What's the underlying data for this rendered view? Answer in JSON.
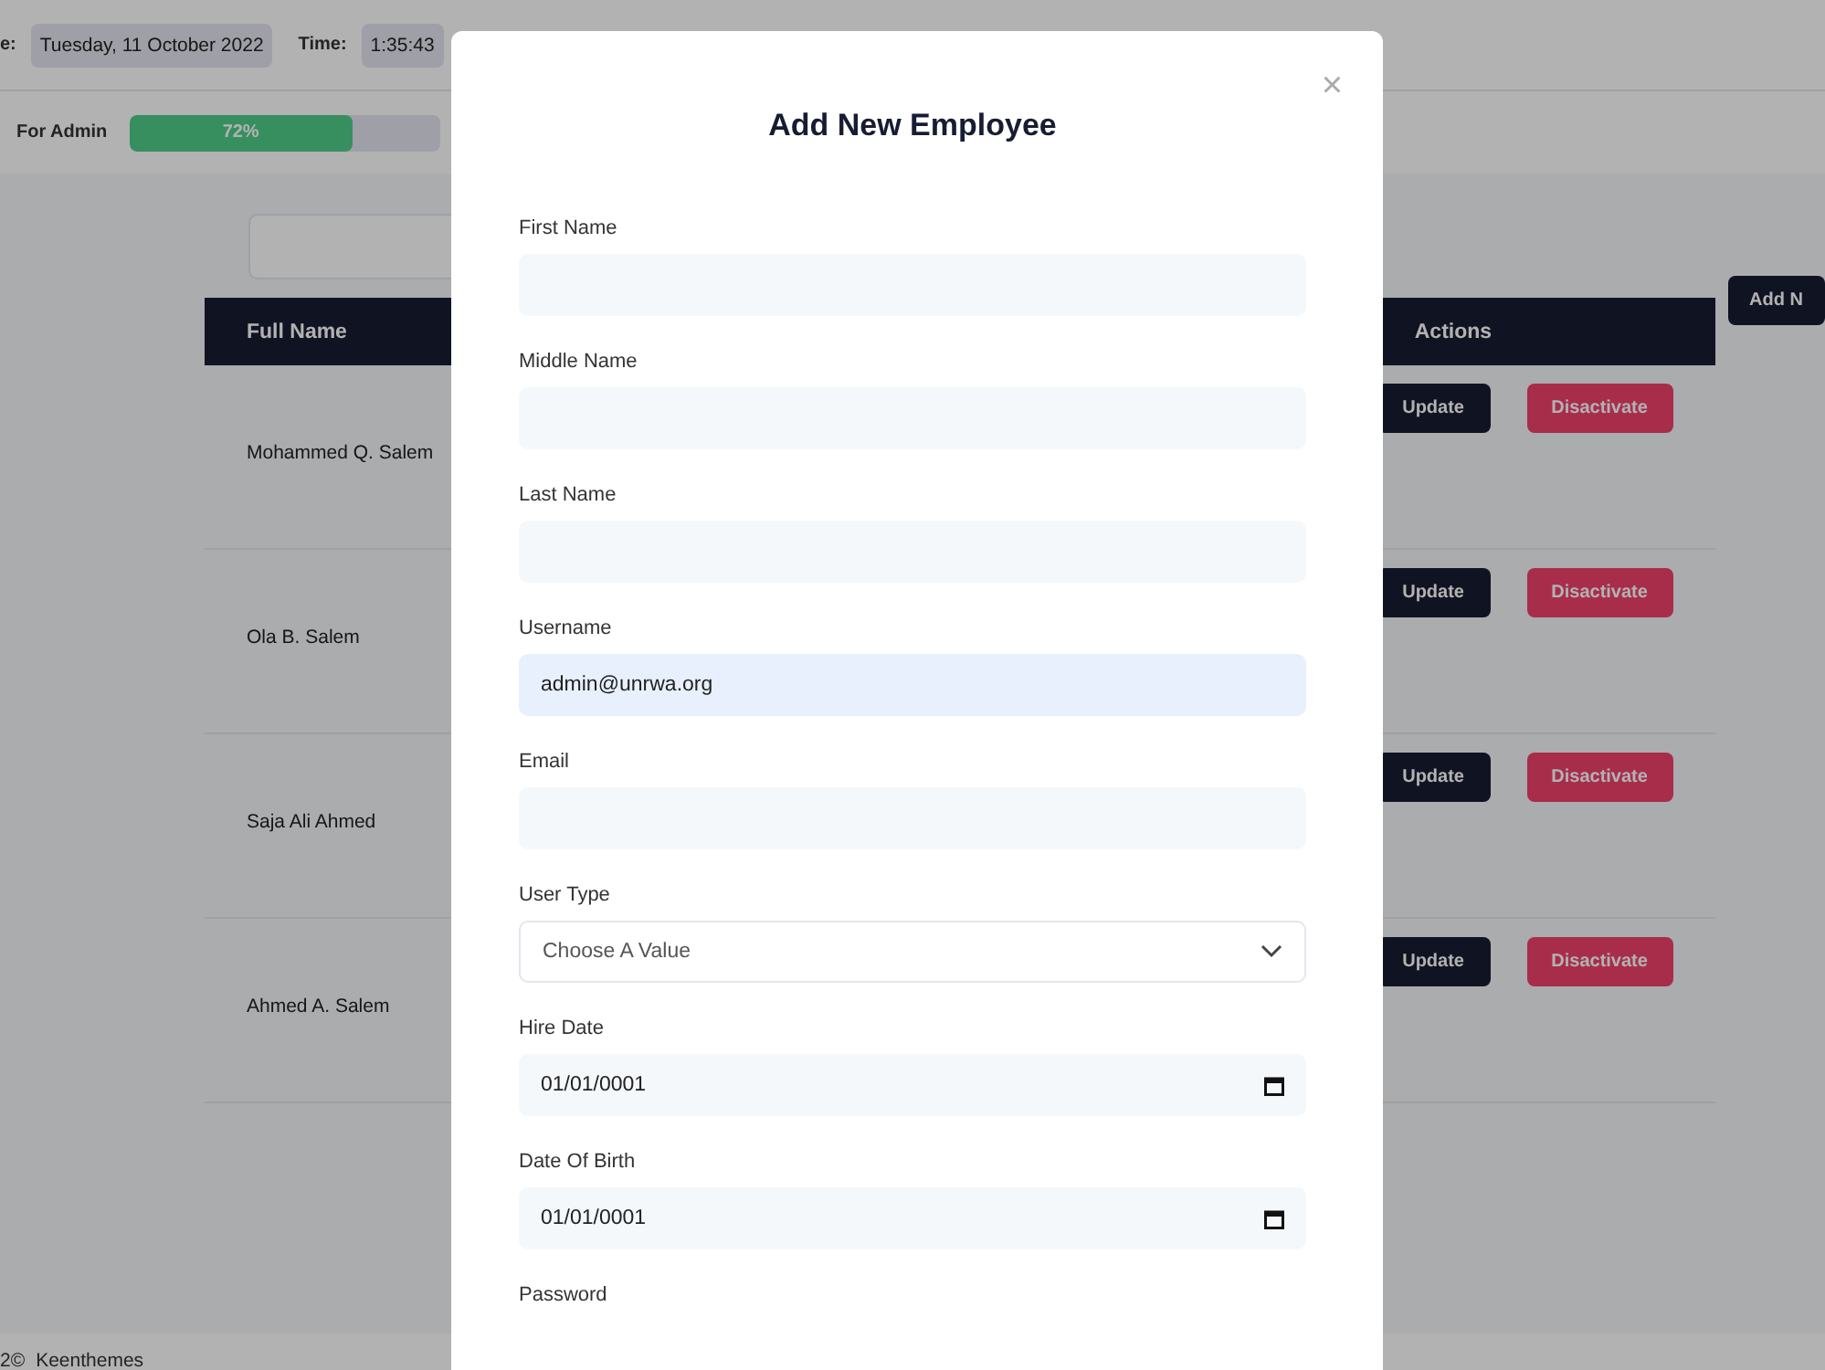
{
  "header": {
    "date_label": "e:",
    "date_value": "Tuesday, 11 October 2022",
    "time_label": "Time:",
    "time_value": "1:35:43"
  },
  "progress": {
    "label": "For Admin",
    "level": 0.72,
    "reading": "72%"
  },
  "add_button": "Add N",
  "table": {
    "columns": [
      "Full Name",
      "Actions"
    ],
    "rows": [
      {
        "name": "Mohammed Q. Salem",
        "update": "Update",
        "deactivate": "Disactivate"
      },
      {
        "name": "Ola B. Salem",
        "update": "Update",
        "deactivate": "Disactivate"
      },
      {
        "name": "Saja Ali Ahmed",
        "update": "Update",
        "deactivate": "Disactivate"
      },
      {
        "name": "Ahmed A. Salem",
        "update": "Update",
        "deactivate": "Disactivate"
      }
    ]
  },
  "footer": {
    "year": "2©",
    "brand": "Keenthemes"
  },
  "modal": {
    "title": "Add New Employee",
    "close": "×",
    "fields": [
      {
        "kind": "text",
        "label": "First Name"
      },
      {
        "kind": "text",
        "label": "Middle Name"
      },
      {
        "kind": "text",
        "label": "Last Name"
      },
      {
        "kind": "text",
        "label": "Username",
        "value": "admin@unrwa.org"
      },
      {
        "kind": "text",
        "label": "Email"
      },
      {
        "kind": "select",
        "label": "User Type",
        "value": "Choose A Value"
      },
      {
        "kind": "date",
        "label": "Hire Date",
        "value": "01/01/0001"
      },
      {
        "kind": "date",
        "label": "Date Of Birth",
        "value": "01/01/0001"
      },
      {
        "kind": "label",
        "label": "Password"
      }
    ]
  }
}
